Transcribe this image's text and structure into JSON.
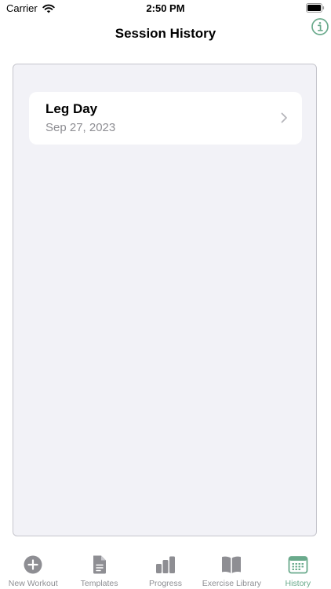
{
  "status_bar": {
    "carrier": "Carrier",
    "time": "2:50 PM"
  },
  "nav": {
    "title": "Session History",
    "info_icon": "info-circle-icon"
  },
  "sessions": [
    {
      "title": "Leg Day",
      "date": "Sep 27, 2023"
    }
  ],
  "tabs": [
    {
      "label": "New Workout",
      "icon": "plus-circle-icon",
      "active": false
    },
    {
      "label": "Templates",
      "icon": "document-icon",
      "active": false
    },
    {
      "label": "Progress",
      "icon": "bar-chart-icon",
      "active": false
    },
    {
      "label": "Exercise Library",
      "icon": "book-icon",
      "active": false
    },
    {
      "label": "History",
      "icon": "calendar-icon",
      "active": true
    }
  ],
  "colors": {
    "accent": "#6aaa8c",
    "inactive": "#8e8e93",
    "background": "#f2f2f7"
  }
}
